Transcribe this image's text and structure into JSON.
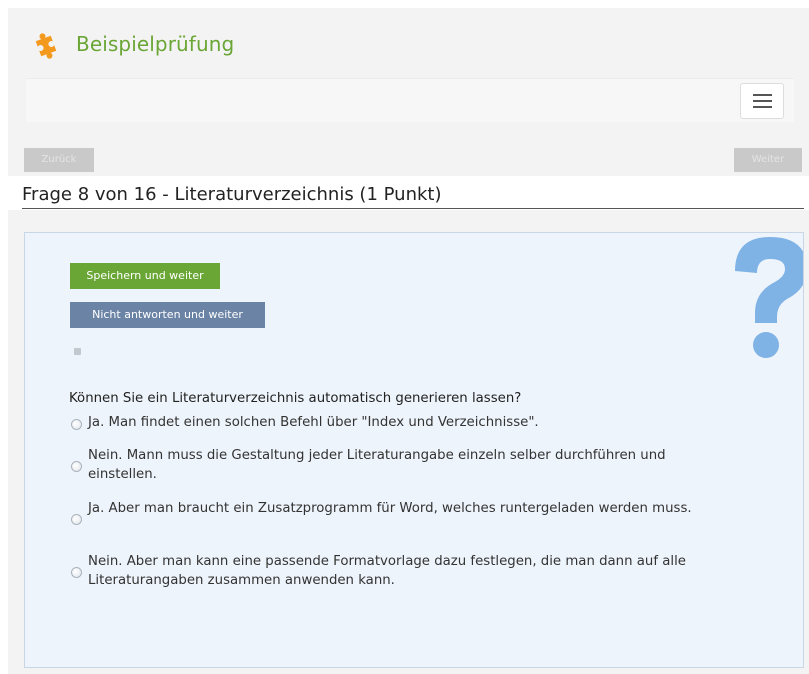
{
  "app": {
    "title": "Beispielprüfung",
    "logo_icon": "puzzle-icon",
    "accent_color": "#6aa635"
  },
  "nav": {
    "menu_icon": "hamburger-icon",
    "prev_label": "Zurück",
    "next_label": "Weiter"
  },
  "question": {
    "title": "Frage 8 von 16 - Literaturverzeichnis (1 Punkt)",
    "save_label": "Speichern und weiter",
    "skip_label": "Nicht antworten und weiter",
    "prompt": "Können Sie ein Literaturverzeichnis automatisch generieren lassen?",
    "options": [
      {
        "label": "Ja. Man findet einen solchen Befehl über \"Index und Verzeichnisse\".",
        "selected": false
      },
      {
        "label": "Nein. Mann muss die Gestaltung jeder Literaturangabe einzeln selber durchführen und einstellen.",
        "selected": false
      },
      {
        "label": "Ja. Aber man braucht ein Zusatzprogramm für Word, welches runtergeladen werden muss.",
        "selected": false
      },
      {
        "label": "Nein. Aber man kann eine passende Formatvorlage dazu festlegen, die man dann auf alle Literaturangaben zusammen anwenden kann.",
        "selected": false
      }
    ]
  },
  "colors": {
    "save_button": "#6aa635",
    "skip_button": "#6b84a6",
    "panel_bg": "#eef4fb",
    "question_mark": "#7fb2e5"
  }
}
